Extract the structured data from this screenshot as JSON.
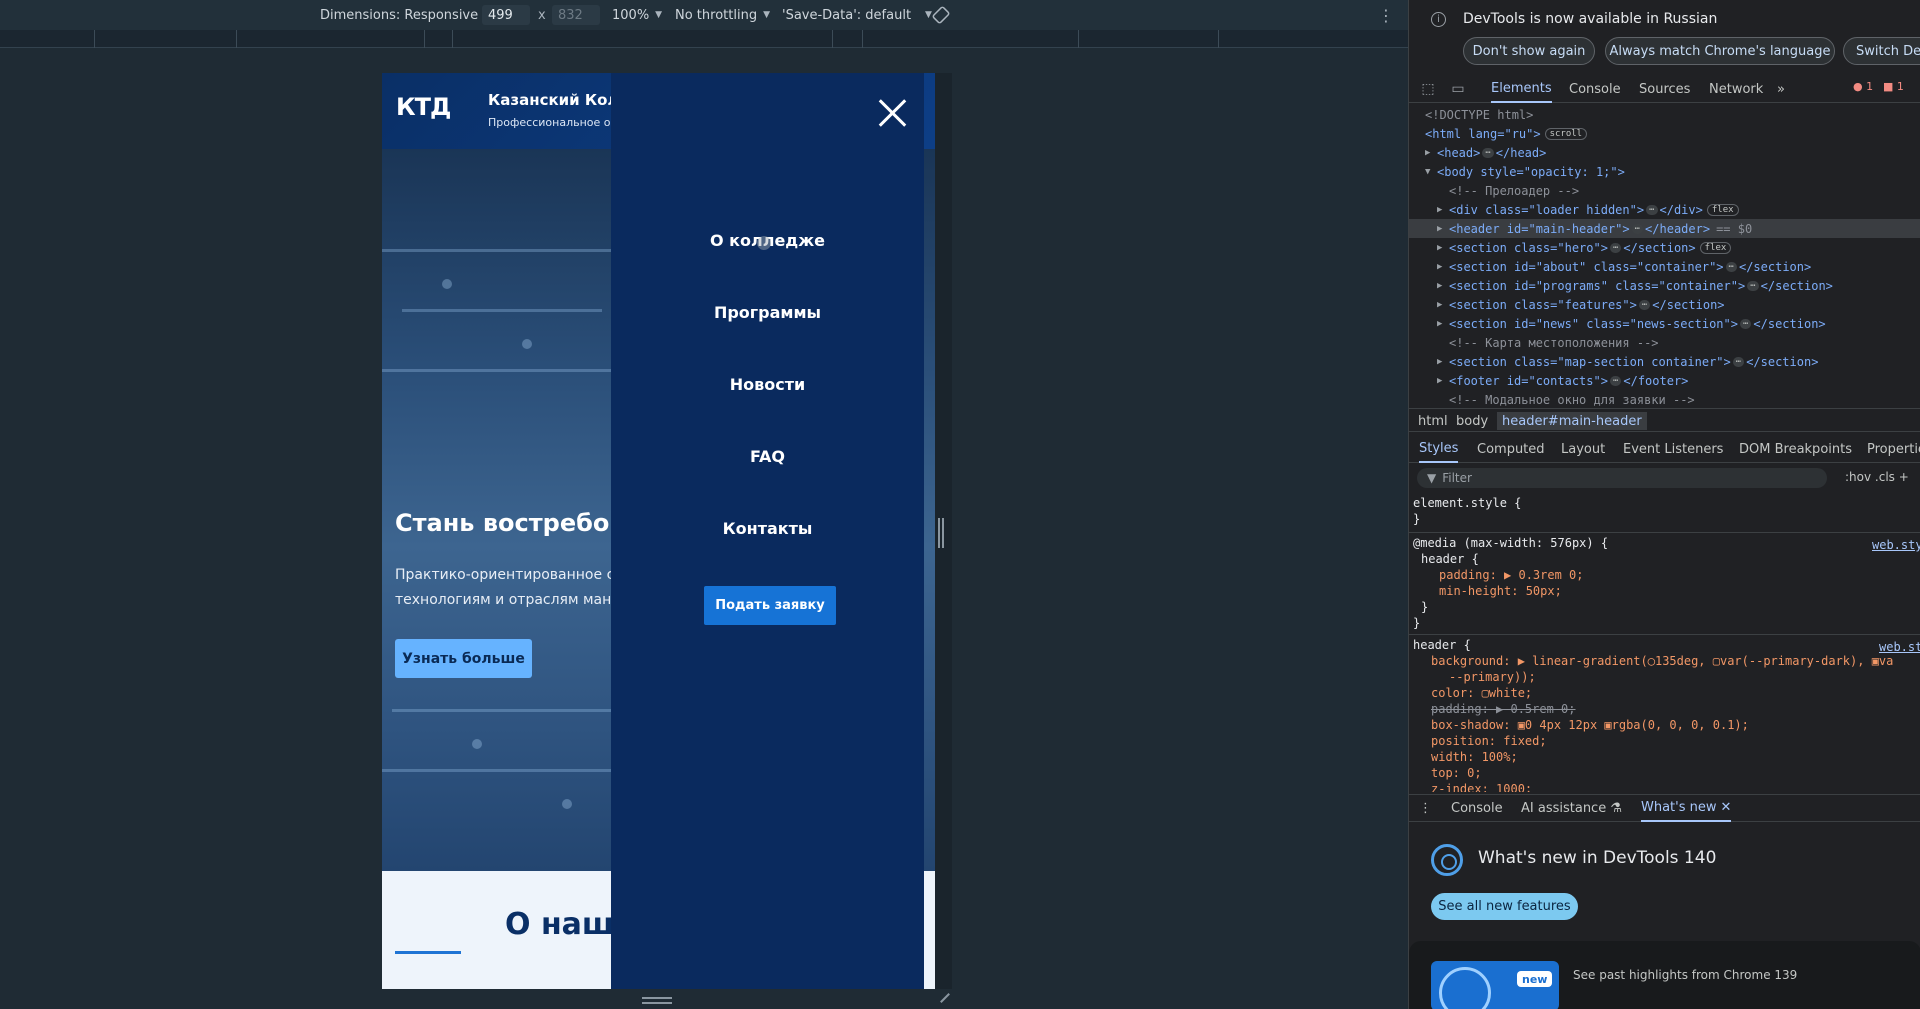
{
  "toolbar": {
    "dimensions_label": "Dimensions: Responsive",
    "width": "499",
    "x_sep": "x",
    "height": "832",
    "zoom": "100%",
    "throttling": "No throttling",
    "save_data": "'Save-Data': default"
  },
  "site": {
    "logo_mark": "КТД",
    "brand_title": "Казанский Кол",
    "brand_subtitle": "Профессиональное о",
    "hero_title": "Стань востребов",
    "hero_text_1": "Практико-ориентированное с",
    "hero_text_2": "технологиям и отраслям ману",
    "hero_button": "Узнать больше",
    "about_title": "О наше",
    "menu": {
      "items": [
        "О колледже",
        "Программы",
        "Новости",
        "FAQ",
        "Контакты"
      ],
      "apply_button": "Подать заявку"
    }
  },
  "devtools": {
    "notice": {
      "text": "DevTools is now available in Russian",
      "btn_dont_show": "Don't show again",
      "btn_match": "Always match Chrome's language",
      "btn_switch": "Switch Dev"
    },
    "tabs": [
      "Elements",
      "Console",
      "Sources",
      "Network"
    ],
    "more_tabs": "»",
    "errors": "1",
    "warnings": "1",
    "dom": {
      "doctype": "<!DOCTYPE html>",
      "html_open": "<html lang=\"ru\">",
      "html_badge": "scroll",
      "head": "<head>",
      "head_close": "</head>",
      "body_open": "<body style=\"opacity: 1;\">",
      "c_preloader": "<!-- Прелоадер -->",
      "loader": "<div class=\"loader hidden\">",
      "loader_close": "</div>",
      "flex": "flex",
      "header_line": "<header id=\"main-header\">",
      "header_close": "</header>",
      "eq0": "== $0",
      "hero": "<section class=\"hero\">",
      "about": "<section id=\"about\" class=\"container\">",
      "programs": "<section id=\"programs\" class=\"container\">",
      "features": "<section class=\"features\">",
      "news": "<section id=\"news\" class=\"news-section\">",
      "c_map": "<!-- Карта местоположения -->",
      "map": "<section class=\"map-section container\">",
      "footer": "<footer id=\"contacts\">",
      "footer_close": "</footer>",
      "section_close": "</section>",
      "c_modal": "<!-- Модальное окно для заявки -->"
    },
    "breadcrumbs": [
      "html",
      "body",
      "header#main-header"
    ],
    "styles_tabs": [
      "Styles",
      "Computed",
      "Layout",
      "Event Listeners",
      "DOM Breakpoints",
      "Properties"
    ],
    "filter_placeholder": "Filter",
    "filter_right": ":hov  .cls  +",
    "styles": {
      "element_style": "element.style {",
      "close": "}",
      "media": "@media (max-width: 576px) {",
      "source": "web.styl",
      "source2": "web.st",
      "header_sel": "header {",
      "padding_media": "padding: ▶ 0.3rem 0;",
      "minheight": "min-height: 50px;",
      "inner_close": "}",
      "header2_sel": "header {",
      "background": "background: ▶ linear-gradient(◯135deg, ▢var(--primary-dark), ▣va",
      "background_cont": "--primary));",
      "color": "color: ▢white;",
      "padding_struck": "padding: ▶ 0.5rem 0;",
      "box_shadow": "box-shadow: ▣0 4px 12px ▣rgba(0, 0, 0, 0.1);",
      "position": "position: fixed;",
      "width": "width: 100%;",
      "top": "top: 0;",
      "zindex": "z-index: 1000;"
    },
    "drawer_tabs": [
      "Console",
      "AI assistance",
      "What's new"
    ],
    "whats_new": {
      "title": "What's new in DevTools 140",
      "button": "See all new features",
      "new_badge": "new",
      "card_text": "See past highlights from Chrome 139"
    },
    "colors": {
      "accent": "#a8c7fa",
      "menu_bg": "#0a2a5e",
      "primary_button": "#1673d6"
    }
  }
}
